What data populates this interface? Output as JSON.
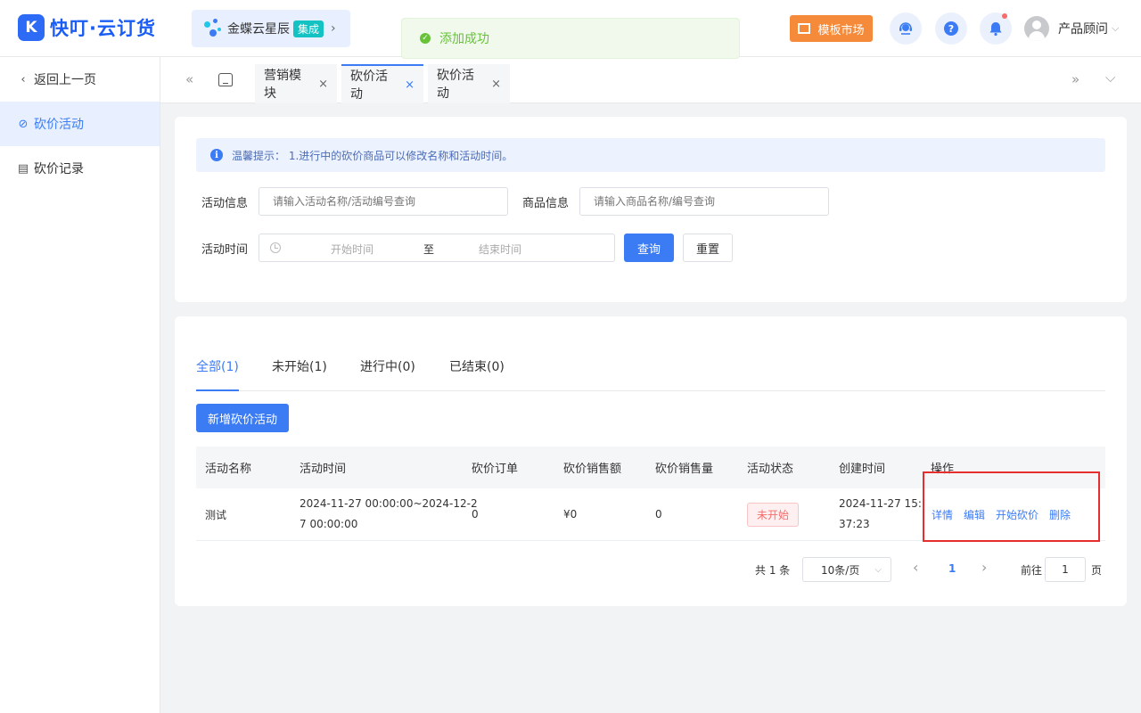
{
  "header": {
    "logo_mark": "K",
    "logo_text": "快叮·云订货",
    "kingdee_name": "金蝶云星辰",
    "kingdee_badge": "集成",
    "kingdee_chev": "›",
    "template_market": "模板市场",
    "user_name": "产品顾问",
    "user_chev": "⌵"
  },
  "toast": {
    "icon": "✓",
    "message": "添加成功"
  },
  "sidebar": {
    "items": [
      {
        "label": "返回上一页",
        "icon": "chevron-left-icon",
        "glyph": "‹"
      },
      {
        "label": "砍价活动",
        "icon": "tag-off-icon",
        "glyph": "⊘"
      },
      {
        "label": "砍价记录",
        "icon": "clipboard-icon",
        "glyph": "▤"
      }
    ]
  },
  "tabbar": {
    "left_arrows": "«",
    "right_arrows": "»",
    "more": "⌵",
    "tabs": [
      {
        "label": "营销模块",
        "close": "×"
      },
      {
        "label": "砍价活动",
        "close": "×"
      },
      {
        "label": "砍价活动",
        "close": "×"
      }
    ]
  },
  "filter": {
    "tip": "温馨提示： 1.进行中的砍价商品可以修改名称和活动时间。",
    "tip_icon": "i",
    "activity_label": "活动信息",
    "activity_placeholder": "请输入活动名称/活动编号查询",
    "goods_label": "商品信息",
    "goods_placeholder": "请输入商品名称/编号查询",
    "time_label": "活动时间",
    "start_placeholder": "开始时间",
    "to": "至",
    "end_placeholder": "结束时间",
    "query_btn": "查询",
    "reset_btn": "重置"
  },
  "list": {
    "tabs": [
      "全部(1)",
      "未开始(1)",
      "进行中(0)",
      "已结束(0)"
    ],
    "add_btn": "新增砍价活动",
    "columns": [
      "活动名称",
      "活动时间",
      "砍价订单",
      "砍价销售额",
      "砍价销售量",
      "活动状态",
      "创建时间",
      "操作"
    ],
    "rows": [
      {
        "name": "测试",
        "time_line1": "2024-11-27 00:00:00~2024-12-2",
        "time_line2": "7 00:00:00",
        "orders": "0",
        "sales_amount": "¥0",
        "sales_qty": "0",
        "status": "未开始",
        "created_line1": "2024-11-27 15:",
        "created_line2": "37:23",
        "ops": [
          "详情",
          "编辑",
          "开始砍价",
          "删除"
        ]
      }
    ]
  },
  "pagination": {
    "total": "共 1 条",
    "page_size": "10条/页",
    "dropdown": "⌵",
    "prev": "‹",
    "current": "1",
    "next": "›",
    "goto_label": "前往",
    "goto_value": "1",
    "page_unit": "页"
  }
}
